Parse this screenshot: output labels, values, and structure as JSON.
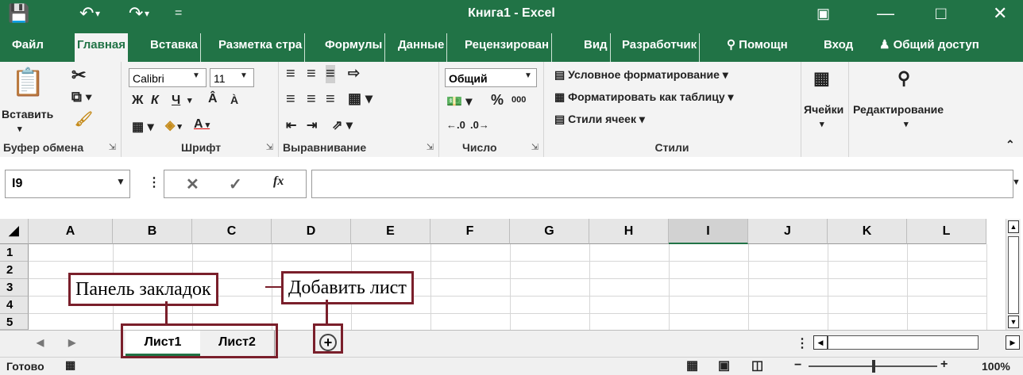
{
  "window": {
    "title": "Книга1 - Excel",
    "save_icon": "save-icon",
    "undo_icon": "undo-icon",
    "redo_icon": "redo-icon",
    "qat_more": "=",
    "controls": [
      "ribbon-display-icon",
      "minimize-icon",
      "maximize-icon",
      "close-icon"
    ]
  },
  "ribbon_tabs": [
    "Файл",
    "Главная",
    "Вставка",
    "Разметка стра",
    "Формулы",
    "Данные",
    "Рецензирован",
    "Вид",
    "Разработчик",
    "Помощн",
    "Вход",
    "Общий доступ"
  ],
  "active_tab": "Главная",
  "clipboard": {
    "paste": "Вставить",
    "label": "Буфер обмена"
  },
  "font": {
    "name": "Calibri",
    "size": "11",
    "bold": "Ж",
    "italic": "К",
    "underline": "Ч",
    "label": "Шрифт"
  },
  "alignment": {
    "label": "Выравнивание"
  },
  "number": {
    "format": "Общий",
    "percent": "%",
    "thousands": "000",
    "label": "Число"
  },
  "styles": {
    "conditional": "Условное форматирование",
    "as_table": "Форматировать как таблицу",
    "cell_styles": "Стили ячеек",
    "label": "Стили"
  },
  "cells": {
    "label": "Ячейки"
  },
  "editing": {
    "label": "Редактирование"
  },
  "formula_bar": {
    "name_box": "I9",
    "fx": "fx",
    "value": ""
  },
  "columns": [
    "A",
    "B",
    "C",
    "D",
    "E",
    "F",
    "G",
    "H",
    "I",
    "J",
    "K",
    "L"
  ],
  "selected_column": "I",
  "rows": [
    "1",
    "2",
    "3",
    "4",
    "5"
  ],
  "sheets": [
    "Лист1",
    "Лист2"
  ],
  "active_sheet": "Лист1",
  "status": {
    "ready": "Готово",
    "zoom": "100%"
  },
  "callouts": {
    "tabs_panel": "Панель закладок",
    "add_sheet": "Добавить лист"
  },
  "colors": {
    "accent": "#217346",
    "callout": "#7a1f2b"
  }
}
